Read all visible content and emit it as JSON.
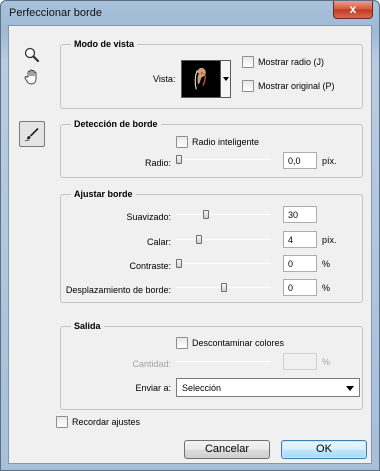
{
  "window": {
    "title": "Perfeccionar borde",
    "close_glyph": "x"
  },
  "tools": [
    {
      "name": "zoom-icon"
    },
    {
      "name": "hand-icon"
    },
    {
      "name": "refine-radius-brush-icon"
    }
  ],
  "view_mode": {
    "title": "Modo de vista",
    "view_label": "Vista:",
    "show_radius_label": "Mostrar radio (J)",
    "show_original_label": "Mostrar original (P)"
  },
  "edge_detection": {
    "title": "Detección de borde",
    "smart_radius_label": "Radio inteligente",
    "radius_label": "Radio:",
    "radius_value": "0,0",
    "radius_unit": "píx.",
    "radius_level": 0.0
  },
  "adjust_edge": {
    "title": "Ajustar borde",
    "smooth": {
      "label": "Suavizado:",
      "value": "30",
      "unit": "",
      "level": 0.3
    },
    "feather": {
      "label": "Calar:",
      "value": "4",
      "unit": "píx.",
      "level": 0.22
    },
    "contrast": {
      "label": "Contraste:",
      "value": "0",
      "unit": "%",
      "level": 0.0
    },
    "shift_edge": {
      "label": "Desplazamiento de borde:",
      "value": "0",
      "unit": "%",
      "level": 0.5
    }
  },
  "output": {
    "title": "Salida",
    "decontaminate_label": "Descontaminar colores",
    "amount_label": "Cantidad:",
    "amount_value": "",
    "amount_unit": "%",
    "output_to_label": "Enviar a:",
    "output_to_value": "Selección"
  },
  "remember_label": "Recordar ajustes",
  "buttons": {
    "cancel": "Cancelar",
    "ok": "OK"
  },
  "colors": {
    "title_bar": "#a9c2dc",
    "close": "#c13a22",
    "default_button": "#bee6fd"
  }
}
